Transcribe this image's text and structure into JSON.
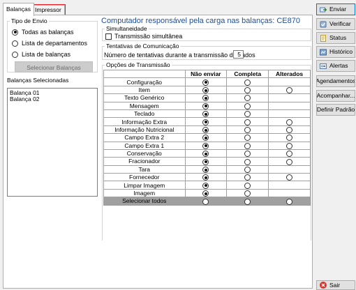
{
  "tabs": [
    {
      "label": "Balanças"
    },
    {
      "label": "Impressor"
    }
  ],
  "tipo_envio": {
    "title": "Tipo de Envio",
    "options": [
      {
        "label": "Todas as balanças",
        "selected": true
      },
      {
        "label": "Lista de departamentos",
        "selected": false
      },
      {
        "label": "Lista de balanças",
        "selected": false
      }
    ],
    "select_button": "Selecionar Balanças"
  },
  "balancas_selecionadas": {
    "title": "Balanças Selecionadas",
    "items": [
      "Balança 01",
      "Balança 02"
    ]
  },
  "header_title": "Computador responsável pela carga nas balanças: CE870",
  "simultaneidade": {
    "title": "Simultaneidade",
    "checkbox_label": "Transmissão simultânea"
  },
  "tentativas": {
    "title": "Tentativas de Comunicação",
    "label": "Número de tentativas durante a transmissão de dados",
    "value": "5"
  },
  "opcoes": {
    "title": "Opções de Transmissão",
    "columns": [
      "",
      "Não enviar",
      "Completa",
      "Alterados"
    ],
    "rows": [
      {
        "label": "Configuração",
        "nao_enviar": true,
        "completa": false,
        "alterados": null
      },
      {
        "label": "Item",
        "nao_enviar": true,
        "completa": false,
        "alterados": false
      },
      {
        "label": "Texto Genérico",
        "nao_enviar": true,
        "completa": false,
        "alterados": null
      },
      {
        "label": "Mensagem",
        "nao_enviar": true,
        "completa": false,
        "alterados": null
      },
      {
        "label": "Teclado",
        "nao_enviar": true,
        "completa": false,
        "alterados": null
      },
      {
        "label": "Informação Extra",
        "nao_enviar": true,
        "completa": false,
        "alterados": false
      },
      {
        "label": "Informação Nutricional",
        "nao_enviar": true,
        "completa": false,
        "alterados": false
      },
      {
        "label": "Campo Extra 2",
        "nao_enviar": true,
        "completa": false,
        "alterados": false
      },
      {
        "label": "Campo Extra 1",
        "nao_enviar": true,
        "completa": false,
        "alterados": false
      },
      {
        "label": "Conservação",
        "nao_enviar": true,
        "completa": false,
        "alterados": false
      },
      {
        "label": "Fracionador",
        "nao_enviar": true,
        "completa": false,
        "alterados": false
      },
      {
        "label": "Tara",
        "nao_enviar": true,
        "completa": false,
        "alterados": null
      },
      {
        "label": "Fornecedor",
        "nao_enviar": true,
        "completa": false,
        "alterados": false
      },
      {
        "label": "Limpar Imagem",
        "nao_enviar": true,
        "completa": false,
        "alterados": null
      },
      {
        "label": "Imagem",
        "nao_enviar": true,
        "completa": false,
        "alterados": null
      }
    ],
    "footer": {
      "label": "Selecionar todos"
    }
  },
  "side_buttons": [
    {
      "label": "Enviar",
      "icon": "send-icon"
    },
    {
      "label": "Verificar",
      "icon": "verify-icon"
    },
    {
      "label": "Status",
      "icon": "status-icon"
    },
    {
      "label": "Histórico",
      "icon": "history-icon"
    },
    {
      "label": "Alertas",
      "icon": "alerts-icon"
    },
    {
      "label": "Agendamentos",
      "icon": ""
    },
    {
      "label": "Acompanhar...",
      "icon": ""
    },
    {
      "label": "Definir Padrão",
      "icon": ""
    }
  ],
  "exit_button": {
    "label": "Sair",
    "icon": "close-icon"
  }
}
